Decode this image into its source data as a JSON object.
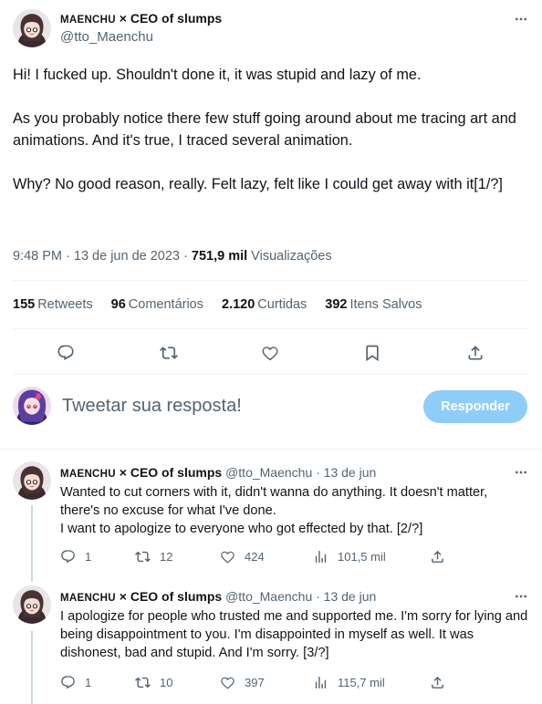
{
  "tweet": {
    "author_name": "MAENCHU × CEO of slumps",
    "author_name_sc": "MAENCHU",
    "author_name_rest": " × CEO of slumps",
    "handle": "@tto_Maenchu",
    "paragraphs": [
      "Hi! I fucked up. Shouldn't done it, it was stupid and lazy of me.",
      "As you probably notice there few stuff going around about me tracing art and animations. And it's true, I traced several animation.",
      "Why? No good reason, really. Felt lazy, felt like I could get away with it[1/?]"
    ],
    "time": "9:48 PM · 13 de jun de 2023 · ",
    "views_count": "751,9 mil",
    "views_label": " Visualizações",
    "stats": {
      "retweets_count": "155",
      "retweets_label": "Retweets",
      "comments_count": "96",
      "comments_label": "Comentários",
      "likes_count": "2.120",
      "likes_label": "Curtidas",
      "saves_count": "392",
      "saves_label": "Itens Salvos"
    },
    "action_icons": [
      "reply-icon",
      "retweet-icon",
      "like-icon",
      "bookmark-icon",
      "share-icon"
    ]
  },
  "composer": {
    "placeholder": "Tweetar sua resposta!",
    "button_label": "Responder"
  },
  "replies": [
    {
      "author_name_sc": "MAENCHU",
      "author_name_rest": " × CEO of slumps",
      "handle_date": " @tto_Maenchu · 13 de jun",
      "text": "Wanted to cut corners with it, didn't wanna do anything. It doesn't matter, there's no excuse for what I've done.\nI want to apologize to everyone who got effected by that. [2/?]",
      "replies": "1",
      "retweets": "12",
      "likes": "424",
      "views": "101,5 mil"
    },
    {
      "author_name_sc": "MAENCHU",
      "author_name_rest": " × CEO of slumps",
      "handle_date": " @tto_Maenchu · 13 de jun",
      "text": "I apologize for people who trusted me and supported me. I'm sorry for lying and being disappointment to you. I'm disappointed in myself as well. It was dishonest, bad and stupid. And I'm sorry. [3/?]",
      "replies": "1",
      "retweets": "10",
      "likes": "397",
      "views": "115,7 mil"
    }
  ],
  "colors": {
    "text": "#0f1419",
    "secondary": "#536471",
    "button_disabled": "#8ecdf8",
    "divider": "#eff3f4"
  }
}
